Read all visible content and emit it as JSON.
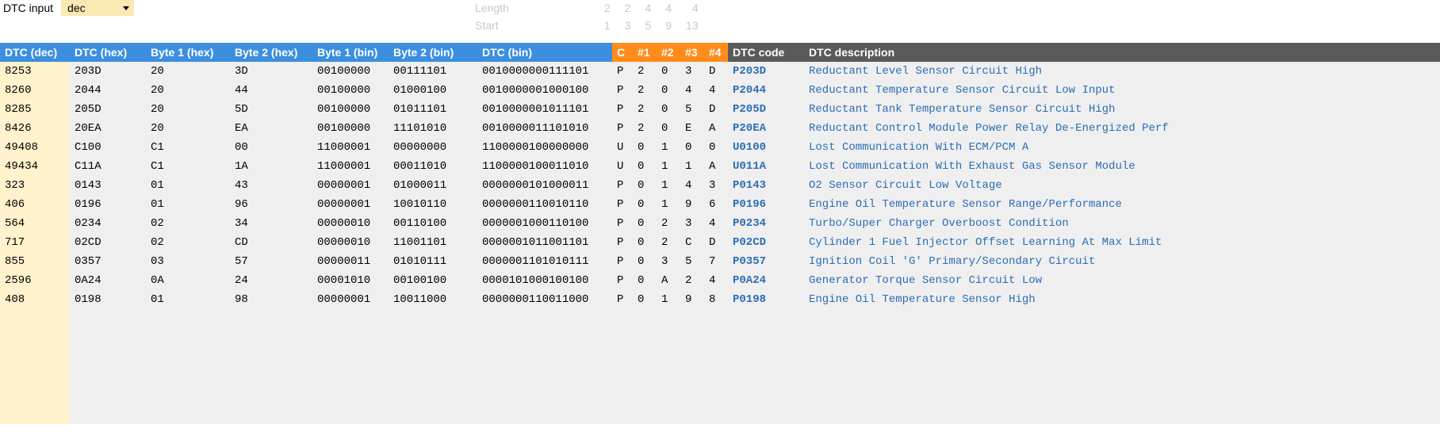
{
  "input": {
    "label": "DTC input",
    "value": "dec"
  },
  "meta": {
    "rows": [
      {
        "label": "Length",
        "vals": [
          "2",
          "2",
          "4",
          "4",
          "4"
        ]
      },
      {
        "label": "Start",
        "vals": [
          "1",
          "3",
          "5",
          "9",
          "13"
        ]
      }
    ]
  },
  "headers": {
    "dec": "DTC (dec)",
    "hex": "DTC (hex)",
    "b1h": "Byte 1 (hex)",
    "b2h": "Byte 2 (hex)",
    "b1b": "Byte 1 (bin)",
    "b2b": "Byte 2 (bin)",
    "dbin": "DTC (bin)",
    "c": "C",
    "n1": "#1",
    "n2": "#2",
    "n3": "#3",
    "n4": "#4",
    "code": "DTC code",
    "desc": "DTC description"
  },
  "rows": [
    {
      "dec": "8253",
      "hex": "203D",
      "b1h": "20",
      "b2h": "3D",
      "b1b": "00100000",
      "b2b": "00111101",
      "dbin": "0010000000111101",
      "c": "P",
      "n1": "2",
      "n2": "0",
      "n3": "3",
      "n4": "D",
      "code": "P203D",
      "desc": "Reductant Level Sensor Circuit High"
    },
    {
      "dec": "8260",
      "hex": "2044",
      "b1h": "20",
      "b2h": "44",
      "b1b": "00100000",
      "b2b": "01000100",
      "dbin": "0010000001000100",
      "c": "P",
      "n1": "2",
      "n2": "0",
      "n3": "4",
      "n4": "4",
      "code": "P2044",
      "desc": "Reductant Temperature Sensor Circuit Low Input"
    },
    {
      "dec": "8285",
      "hex": "205D",
      "b1h": "20",
      "b2h": "5D",
      "b1b": "00100000",
      "b2b": "01011101",
      "dbin": "0010000001011101",
      "c": "P",
      "n1": "2",
      "n2": "0",
      "n3": "5",
      "n4": "D",
      "code": "P205D",
      "desc": "Reductant Tank Temperature Sensor Circuit High"
    },
    {
      "dec": "8426",
      "hex": "20EA",
      "b1h": "20",
      "b2h": "EA",
      "b1b": "00100000",
      "b2b": "11101010",
      "dbin": "0010000011101010",
      "c": "P",
      "n1": "2",
      "n2": "0",
      "n3": "E",
      "n4": "A",
      "code": "P20EA",
      "desc": "Reductant Control Module Power Relay De-Energized Perf"
    },
    {
      "dec": "49408",
      "hex": "C100",
      "b1h": "C1",
      "b2h": "00",
      "b1b": "11000001",
      "b2b": "00000000",
      "dbin": "1100000100000000",
      "c": "U",
      "n1": "0",
      "n2": "1",
      "n3": "0",
      "n4": "0",
      "code": "U0100",
      "desc": "Lost Communication With ECM/PCM A"
    },
    {
      "dec": "49434",
      "hex": "C11A",
      "b1h": "C1",
      "b2h": "1A",
      "b1b": "11000001",
      "b2b": "00011010",
      "dbin": "1100000100011010",
      "c": "U",
      "n1": "0",
      "n2": "1",
      "n3": "1",
      "n4": "A",
      "code": "U011A",
      "desc": "Lost Communication With Exhaust Gas Sensor Module"
    },
    {
      "dec": "323",
      "hex": "0143",
      "b1h": "01",
      "b2h": "43",
      "b1b": "00000001",
      "b2b": "01000011",
      "dbin": "0000000101000011",
      "c": "P",
      "n1": "0",
      "n2": "1",
      "n3": "4",
      "n4": "3",
      "code": "P0143",
      "desc": "O2 Sensor Circuit Low Voltage"
    },
    {
      "dec": "406",
      "hex": "0196",
      "b1h": "01",
      "b2h": "96",
      "b1b": "00000001",
      "b2b": "10010110",
      "dbin": "0000000110010110",
      "c": "P",
      "n1": "0",
      "n2": "1",
      "n3": "9",
      "n4": "6",
      "code": "P0196",
      "desc": "Engine Oil Temperature Sensor Range/Performance"
    },
    {
      "dec": "564",
      "hex": "0234",
      "b1h": "02",
      "b2h": "34",
      "b1b": "00000010",
      "b2b": "00110100",
      "dbin": "0000001000110100",
      "c": "P",
      "n1": "0",
      "n2": "2",
      "n3": "3",
      "n4": "4",
      "code": "P0234",
      "desc": "Turbo/Super Charger Overboost Condition"
    },
    {
      "dec": "717",
      "hex": "02CD",
      "b1h": "02",
      "b2h": "CD",
      "b1b": "00000010",
      "b2b": "11001101",
      "dbin": "0000001011001101",
      "c": "P",
      "n1": "0",
      "n2": "2",
      "n3": "C",
      "n4": "D",
      "code": "P02CD",
      "desc": "Cylinder 1 Fuel Injector Offset Learning At Max Limit"
    },
    {
      "dec": "855",
      "hex": "0357",
      "b1h": "03",
      "b2h": "57",
      "b1b": "00000011",
      "b2b": "01010111",
      "dbin": "0000001101010111",
      "c": "P",
      "n1": "0",
      "n2": "3",
      "n3": "5",
      "n4": "7",
      "code": "P0357",
      "desc": "Ignition Coil 'G' Primary/Secondary Circuit"
    },
    {
      "dec": "2596",
      "hex": "0A24",
      "b1h": "0A",
      "b2h": "24",
      "b1b": "00001010",
      "b2b": "00100100",
      "dbin": "0000101000100100",
      "c": "P",
      "n1": "0",
      "n2": "A",
      "n3": "2",
      "n4": "4",
      "code": "P0A24",
      "desc": "Generator Torque Sensor Circuit Low"
    },
    {
      "dec": "408",
      "hex": "0198",
      "b1h": "01",
      "b2h": "98",
      "b1b": "00000001",
      "b2b": "10011000",
      "dbin": "0000000110011000",
      "c": "P",
      "n1": "0",
      "n2": "1",
      "n3": "9",
      "n4": "8",
      "code": "P0198",
      "desc": "Engine Oil Temperature Sensor High"
    }
  ]
}
